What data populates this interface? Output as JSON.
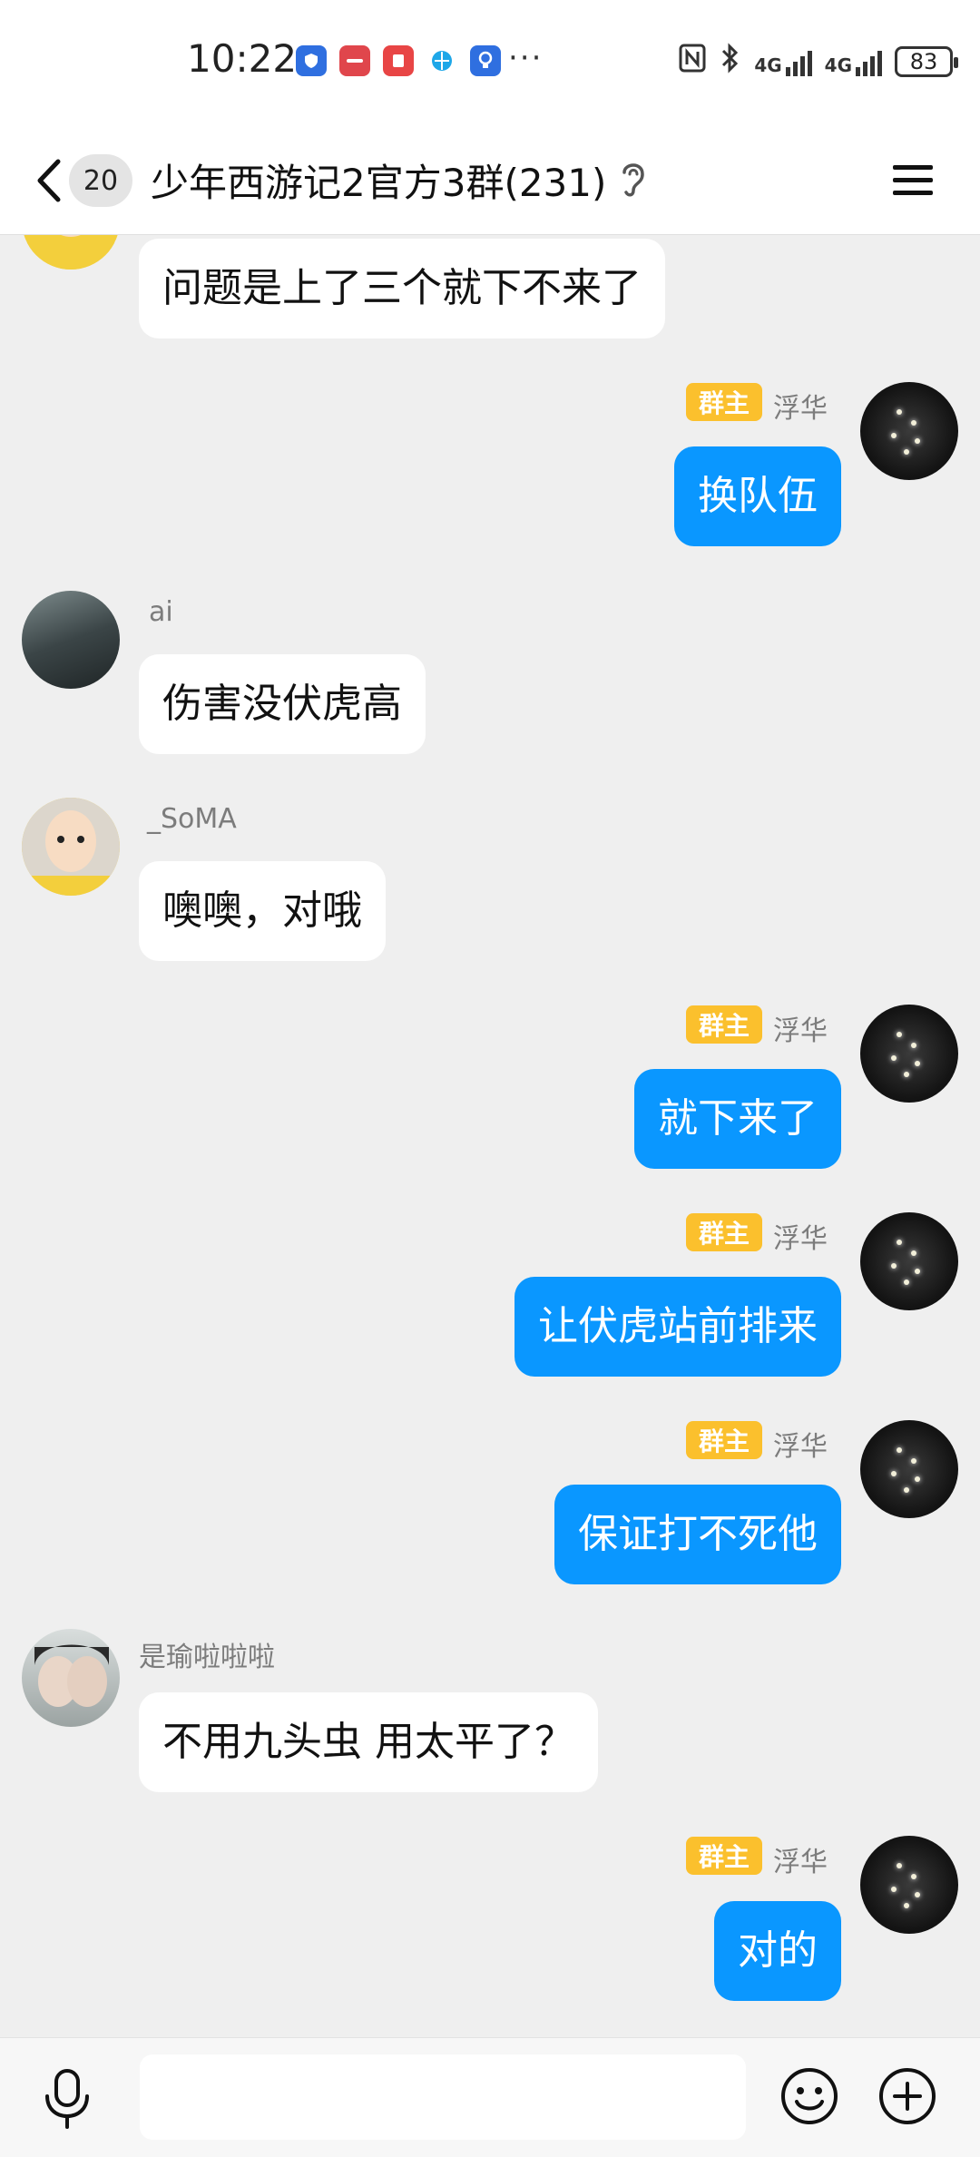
{
  "status_bar": {
    "time": "10:22",
    "more": "···",
    "network_label_1": "4G",
    "network_label_2": "4G",
    "battery": "83",
    "app_icons": [
      "shield-app-icon",
      "huawei-app-icon",
      "book-app-icon",
      "sphere-app-icon",
      "bulb-app-icon"
    ],
    "colors": {
      "shield": "#2f6fe0",
      "huawei": "#e0464c",
      "book": "#e84545",
      "sphere": "#1ea7e8",
      "bulb": "#2f6fe0"
    }
  },
  "header": {
    "back_icon": "chevron-left-icon",
    "unread_count": "20",
    "title": "少年西游记2官方3群(231)",
    "ear_icon": "ear-icon",
    "menu_icon": "menu-icon"
  },
  "messages": [
    {
      "side": "in",
      "sender": "",
      "text": "问题是上了三个就下不来了"
    },
    {
      "side": "out",
      "badge": "群主",
      "sender": "浮华",
      "text": "换队伍"
    },
    {
      "side": "in",
      "sender": "ai",
      "text": "伤害没伏虎高"
    },
    {
      "side": "in",
      "sender": "_SoMA",
      "text": "噢噢，对哦"
    },
    {
      "side": "out",
      "badge": "群主",
      "sender": "浮华",
      "text": "就下来了"
    },
    {
      "side": "out",
      "badge": "群主",
      "sender": "浮华",
      "text": "让伏虎站前排来"
    },
    {
      "side": "out",
      "badge": "群主",
      "sender": "浮华",
      "text": "保证打不死他"
    },
    {
      "side": "in",
      "sender": "是瑜啦啦啦",
      "text": "不用九头虫 用太平了？"
    },
    {
      "side": "out",
      "badge": "群主",
      "sender": "浮华",
      "text": "对的"
    }
  ],
  "input_bar": {
    "voice_icon": "microphone-icon",
    "placeholder": "",
    "emoji_icon": "emoji-icon",
    "plus_icon": "plus-icon"
  },
  "colors": {
    "outgoing_bubble": "#0a97ff",
    "incoming_bubble": "#ffffff",
    "owner_badge": "#fbc02d",
    "background": "#efefef"
  }
}
